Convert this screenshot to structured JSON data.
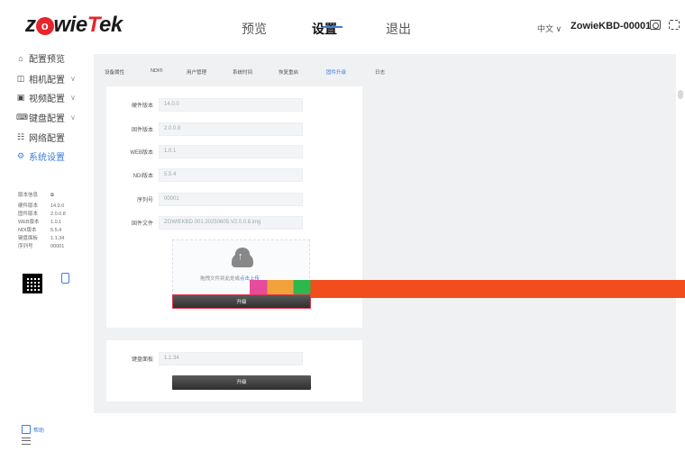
{
  "brand": {
    "logo_pre": "z",
    "logo_o": "o",
    "logo_mid": "wie",
    "logo_t": "T",
    "logo_post": "ek"
  },
  "nav": {
    "preview": "预览",
    "settings": "设置",
    "logout": "退出"
  },
  "header": {
    "language": "中文",
    "device_name": "ZowieKBD-00001"
  },
  "sidebar": {
    "items": [
      {
        "icon": "home-icon",
        "label": "配置预览"
      },
      {
        "icon": "camera-icon",
        "label": "相机配置"
      },
      {
        "icon": "video-icon",
        "label": "视频配置"
      },
      {
        "icon": "keyboard-icon",
        "label": "键盘配置"
      },
      {
        "icon": "network-icon",
        "label": "网络配置"
      },
      {
        "icon": "gear-icon",
        "label": "系统设置"
      }
    ],
    "info_title": "版本信息",
    "info": [
      {
        "label": "硬件版本",
        "value": "14.0.0"
      },
      {
        "label": "固件版本",
        "value": "2.0.0.8"
      },
      {
        "label": "WEB版本",
        "value": "1.0.1"
      },
      {
        "label": "NDI版本",
        "value": "5.5.4"
      },
      {
        "label": "键盘面板",
        "value": "1.1.34"
      },
      {
        "label": "序列号",
        "value": "00001"
      }
    ],
    "help_label": "帮助"
  },
  "tabs": [
    "设备属性",
    "NDI®",
    "用户管理",
    "系统时间",
    "恢复重启",
    "固件升级",
    "日志"
  ],
  "active_tab": "固件升级",
  "firmware": {
    "fields": [
      {
        "label": "硬件版本",
        "value": "14.0.0"
      },
      {
        "label": "固件版本",
        "value": "2.0.0.8"
      },
      {
        "label": "WEB版本",
        "value": "1.0.1"
      },
      {
        "label": "NDI版本",
        "value": "5.5.4"
      },
      {
        "label": "序列号",
        "value": "00001"
      },
      {
        "label": "固件文件",
        "value": "ZOWIEKBD.001.20250605.V2.0.0.8.img"
      }
    ],
    "upload_hint": "拖拽文件到此处或",
    "upload_link": "点击上传",
    "upgrade_label": "升级"
  },
  "keyboard_panel": {
    "label": "键盘面板",
    "value": "1.1.34",
    "upgrade_label": "升级"
  },
  "colors": {
    "accent": "#3b7ddd",
    "brand_red": "#e6262b"
  }
}
